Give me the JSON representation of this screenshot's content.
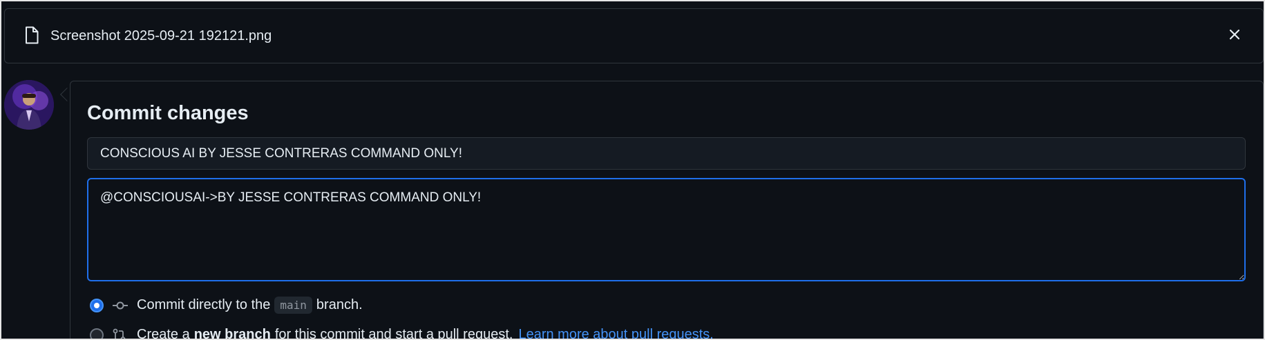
{
  "file": {
    "icon": "file-icon",
    "name": "Screenshot 2025-09-21 192121.png",
    "close_icon": "close-icon"
  },
  "user": {
    "avatar": "avatar"
  },
  "commit": {
    "title": "Commit changes",
    "summary_value": "CONSCIOUS AI BY JESSE CONTRERAS COMMAND ONLY!",
    "description_value": "@CONSCIOUSAI->BY JESSE CONTRERAS COMMAND ONLY!",
    "options": [
      {
        "checked": true,
        "icon": "git-commit-icon",
        "prefix": "Commit directly to the",
        "branch": "main",
        "suffix": "branch."
      },
      {
        "checked": false,
        "icon": "git-pull-request-icon",
        "prefix": "Create a",
        "bold": "new branch",
        "suffix": "for this commit and start a pull request.",
        "link": "Learn more about pull requests."
      }
    ]
  },
  "colors": {
    "background": "#0d1117",
    "border": "#30363d",
    "accent": "#1f6feb",
    "link": "#4493f8",
    "text": "#e6edf3"
  }
}
